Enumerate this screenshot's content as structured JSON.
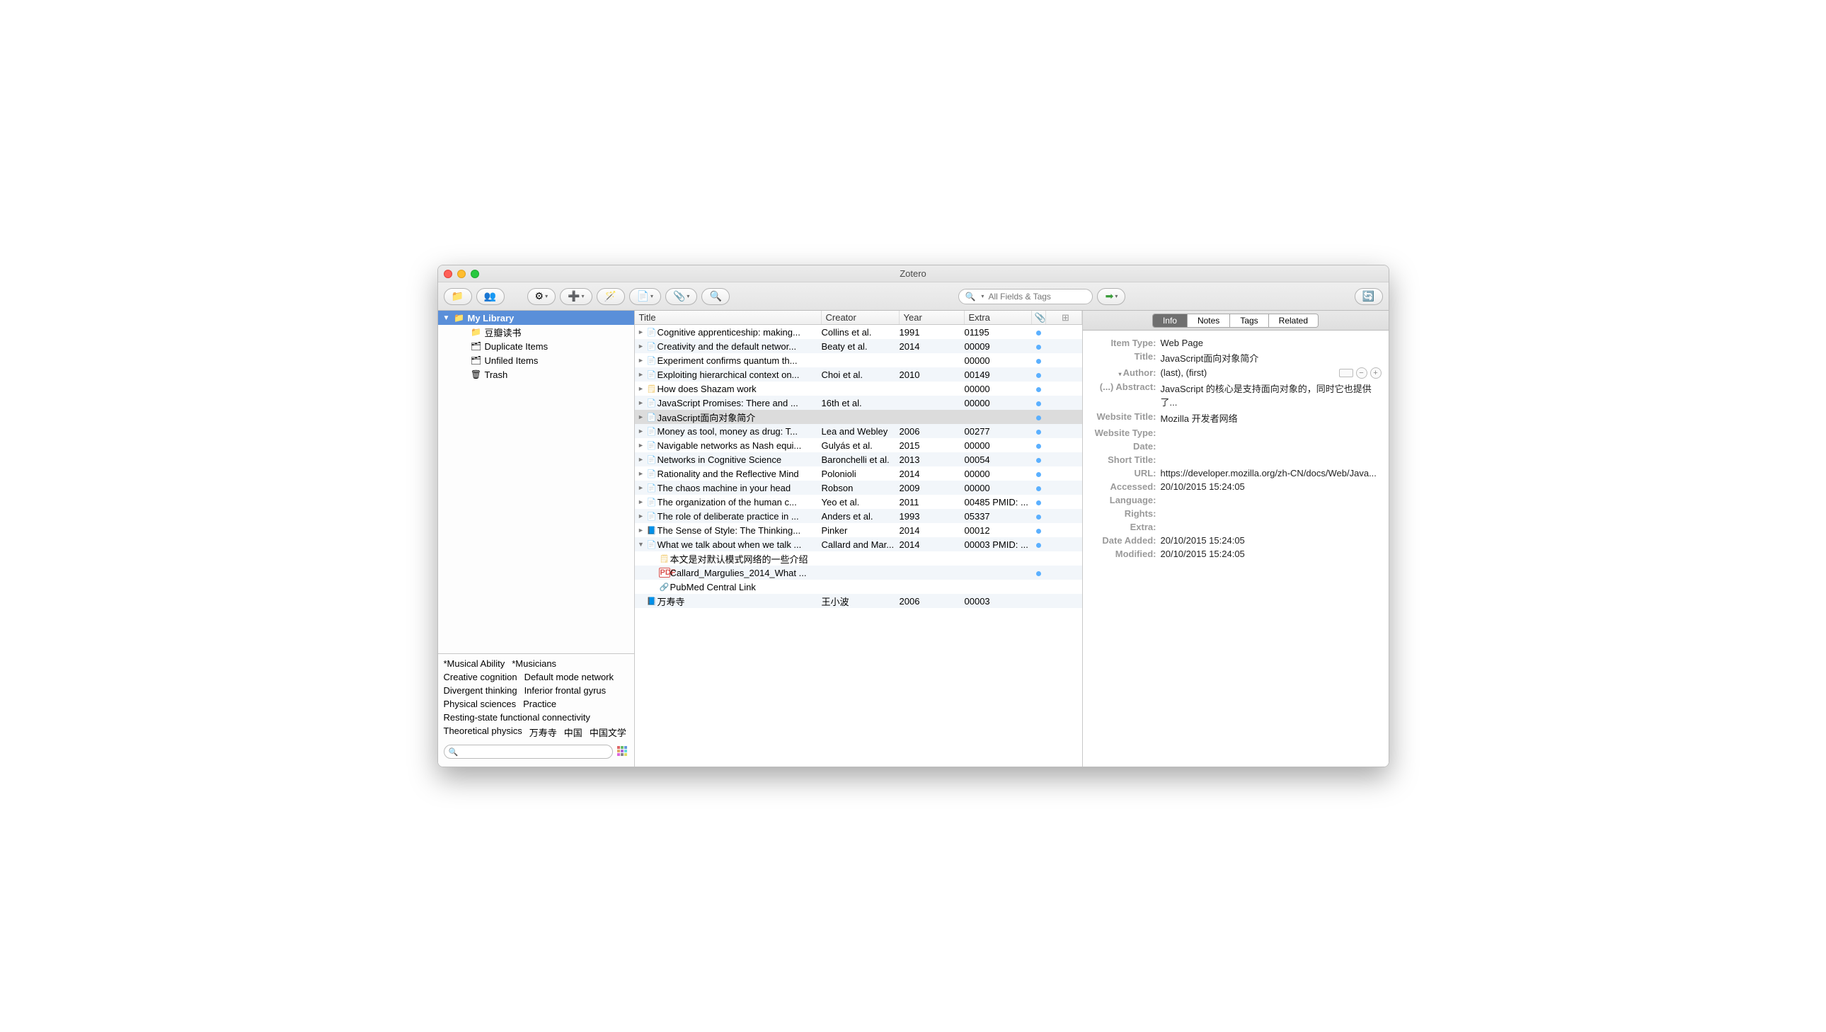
{
  "window_title": "Zotero",
  "toolbar": {
    "search_placeholder": "All Fields & Tags"
  },
  "sidebar": {
    "items": [
      {
        "label": "My Library",
        "selected": true,
        "indent": 0,
        "icon": "📁",
        "expanded": true
      },
      {
        "label": "豆瓣读书",
        "indent": 1,
        "icon": "📁"
      },
      {
        "label": "Duplicate Items",
        "indent": 1,
        "icon": "🗂"
      },
      {
        "label": "Unfiled Items",
        "indent": 1,
        "icon": "🗂"
      },
      {
        "label": "Trash",
        "indent": 1,
        "icon": "🗑"
      }
    ],
    "tags": [
      "*Musical Ability",
      "*Musicians",
      "Creative cognition",
      "Default mode network",
      "Divergent thinking",
      "Inferior frontal gyrus",
      "Physical sciences",
      "Practice",
      "Resting-state functional connectivity",
      "Theoretical physics",
      "万寿寺",
      "中国",
      "中国文学"
    ]
  },
  "columns": {
    "title": "Title",
    "creator": "Creator",
    "year": "Year",
    "extra": "Extra"
  },
  "items": [
    {
      "twist": "►",
      "icon": "page",
      "title": "Cognitive apprenticeship: making...",
      "creator": "Collins et al.",
      "year": "1991",
      "extra": "01195",
      "dot": true,
      "alt": false
    },
    {
      "twist": "►",
      "icon": "page",
      "title": "Creativity and the default networ...",
      "creator": "Beaty et al.",
      "year": "2014",
      "extra": "00009",
      "dot": true,
      "alt": true
    },
    {
      "twist": "►",
      "icon": "page",
      "title": "Experiment confirms quantum th...",
      "creator": "",
      "year": "",
      "extra": "00000",
      "dot": true,
      "alt": false
    },
    {
      "twist": "►",
      "icon": "page",
      "title": "Exploiting hierarchical context on...",
      "creator": "Choi et al.",
      "year": "2010",
      "extra": "00149",
      "dot": true,
      "alt": true
    },
    {
      "twist": "►",
      "icon": "note",
      "title": "How does Shazam work",
      "creator": "",
      "year": "",
      "extra": "00000",
      "dot": true,
      "alt": false
    },
    {
      "twist": "►",
      "icon": "page",
      "title": "JavaScript Promises: There and ...",
      "creator": "16th et al.",
      "year": "",
      "extra": "00000",
      "dot": true,
      "alt": true
    },
    {
      "twist": "►",
      "icon": "page",
      "title": "JavaScript面向对象简介",
      "creator": "",
      "year": "",
      "extra": "",
      "dot": true,
      "alt": false,
      "selected": true
    },
    {
      "twist": "►",
      "icon": "doc",
      "title": "Money as tool, money as drug: T...",
      "creator": "Lea and Webley",
      "year": "2006",
      "extra": "00277",
      "dot": true,
      "alt": true
    },
    {
      "twist": "►",
      "icon": "doc",
      "title": "Navigable networks as Nash equi...",
      "creator": "Gulyás et al.",
      "year": "2015",
      "extra": "00000",
      "dot": true,
      "alt": false
    },
    {
      "twist": "►",
      "icon": "doc",
      "title": "Networks in Cognitive Science",
      "creator": "Baronchelli et al.",
      "year": "2013",
      "extra": "00054",
      "dot": true,
      "alt": true
    },
    {
      "twist": "►",
      "icon": "doc",
      "title": "Rationality and the Reflective Mind",
      "creator": "Polonioli",
      "year": "2014",
      "extra": "00000",
      "dot": true,
      "alt": false
    },
    {
      "twist": "►",
      "icon": "doc",
      "title": "The chaos machine in your head",
      "creator": "Robson",
      "year": "2009",
      "extra": "00000",
      "dot": true,
      "alt": true
    },
    {
      "twist": "►",
      "icon": "doc",
      "title": "The organization of the human c...",
      "creator": "Yeo et al.",
      "year": "2011",
      "extra": "00485 PMID: ...",
      "dot": true,
      "alt": false
    },
    {
      "twist": "►",
      "icon": "doc",
      "title": "The role of deliberate practice in ...",
      "creator": "Anders et al.",
      "year": "1993",
      "extra": "05337",
      "dot": true,
      "alt": true
    },
    {
      "twist": "►",
      "icon": "book",
      "title": "The Sense of Style: The Thinking...",
      "creator": "Pinker",
      "year": "2014",
      "extra": "00012",
      "dot": true,
      "alt": false
    },
    {
      "twist": "▼",
      "icon": "doc",
      "title": "What we talk about when we talk ...",
      "creator": "Callard and Mar...",
      "year": "2014",
      "extra": "00003 PMID: ...",
      "dot": true,
      "alt": true
    },
    {
      "child": true,
      "icon": "note",
      "title": "本文是对默认模式网络的一些介绍",
      "creator": "",
      "year": "",
      "extra": "",
      "alt": false
    },
    {
      "child": true,
      "icon": "pdf",
      "title": "Callard_Margulies_2014_What ...",
      "creator": "",
      "year": "",
      "extra": "",
      "dot": true,
      "alt": true
    },
    {
      "child": true,
      "icon": "link",
      "title": "PubMed Central Link",
      "creator": "",
      "year": "",
      "extra": "",
      "alt": false
    },
    {
      "twist": "",
      "icon": "book",
      "title": "万寿寺",
      "creator": "王小波",
      "year": "2006",
      "extra": "00003",
      "alt": true
    }
  ],
  "right_tabs": [
    "Info",
    "Notes",
    "Tags",
    "Related"
  ],
  "right_active": 0,
  "fields": [
    {
      "label": "Item Type:",
      "value": "Web Page"
    },
    {
      "label": "Title:",
      "value": "JavaScript面向对象简介"
    },
    {
      "label": "Author:",
      "value": "(last), (first)",
      "author": true,
      "twist": "▾"
    },
    {
      "label": "(...) Abstract:",
      "value": "JavaScript 的核心是支持面向对象的，同时它也提供了..."
    },
    {
      "label": "Website Title:",
      "value": "Mozilla 开发者网络"
    },
    {
      "label": "Website Type:",
      "value": ""
    },
    {
      "label": "Date:",
      "value": ""
    },
    {
      "label": "Short Title:",
      "value": ""
    },
    {
      "label": "URL:",
      "value": "https://developer.mozilla.org/zh-CN/docs/Web/Java..."
    },
    {
      "label": "Accessed:",
      "value": "20/10/2015 15:24:05"
    },
    {
      "label": "Language:",
      "value": ""
    },
    {
      "label": "Rights:",
      "value": ""
    },
    {
      "label": "Extra:",
      "value": ""
    },
    {
      "label": "Date Added:",
      "value": "20/10/2015 15:24:05"
    },
    {
      "label": "Modified:",
      "value": "20/10/2015 15:24:05"
    }
  ]
}
